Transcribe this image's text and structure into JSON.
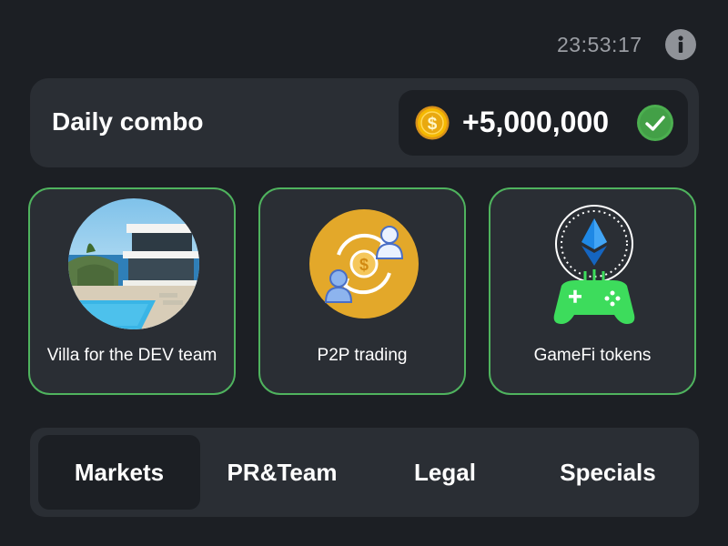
{
  "header": {
    "timer": "23:53:17",
    "info_icon": "info-icon"
  },
  "daily_combo": {
    "title": "Daily combo",
    "reward": "+5,000,000",
    "reward_icon": "coin-icon",
    "status_icon": "check-icon",
    "status": "completed"
  },
  "cards": [
    {
      "label": "Villa for the DEV team",
      "icon": "villa-image",
      "found": true
    },
    {
      "label": "P2P trading",
      "icon": "p2p-trading-icon",
      "found": true
    },
    {
      "label": "GameFi tokens",
      "icon": "gamefi-tokens-icon",
      "found": true
    }
  ],
  "tabs": [
    {
      "label": "Markets",
      "active": true
    },
    {
      "label": "PR&Team",
      "active": false
    },
    {
      "label": "Legal",
      "active": false
    },
    {
      "label": "Specials",
      "active": false
    }
  ],
  "colors": {
    "background": "#1c1f24",
    "panel": "#2a2e34",
    "card_border": "#4fb35e",
    "check_green": "#4caf50",
    "coin_gold": "#f5b800",
    "p2p_circle": "#e3a82a",
    "gamepad_green": "#3ddc5c"
  }
}
